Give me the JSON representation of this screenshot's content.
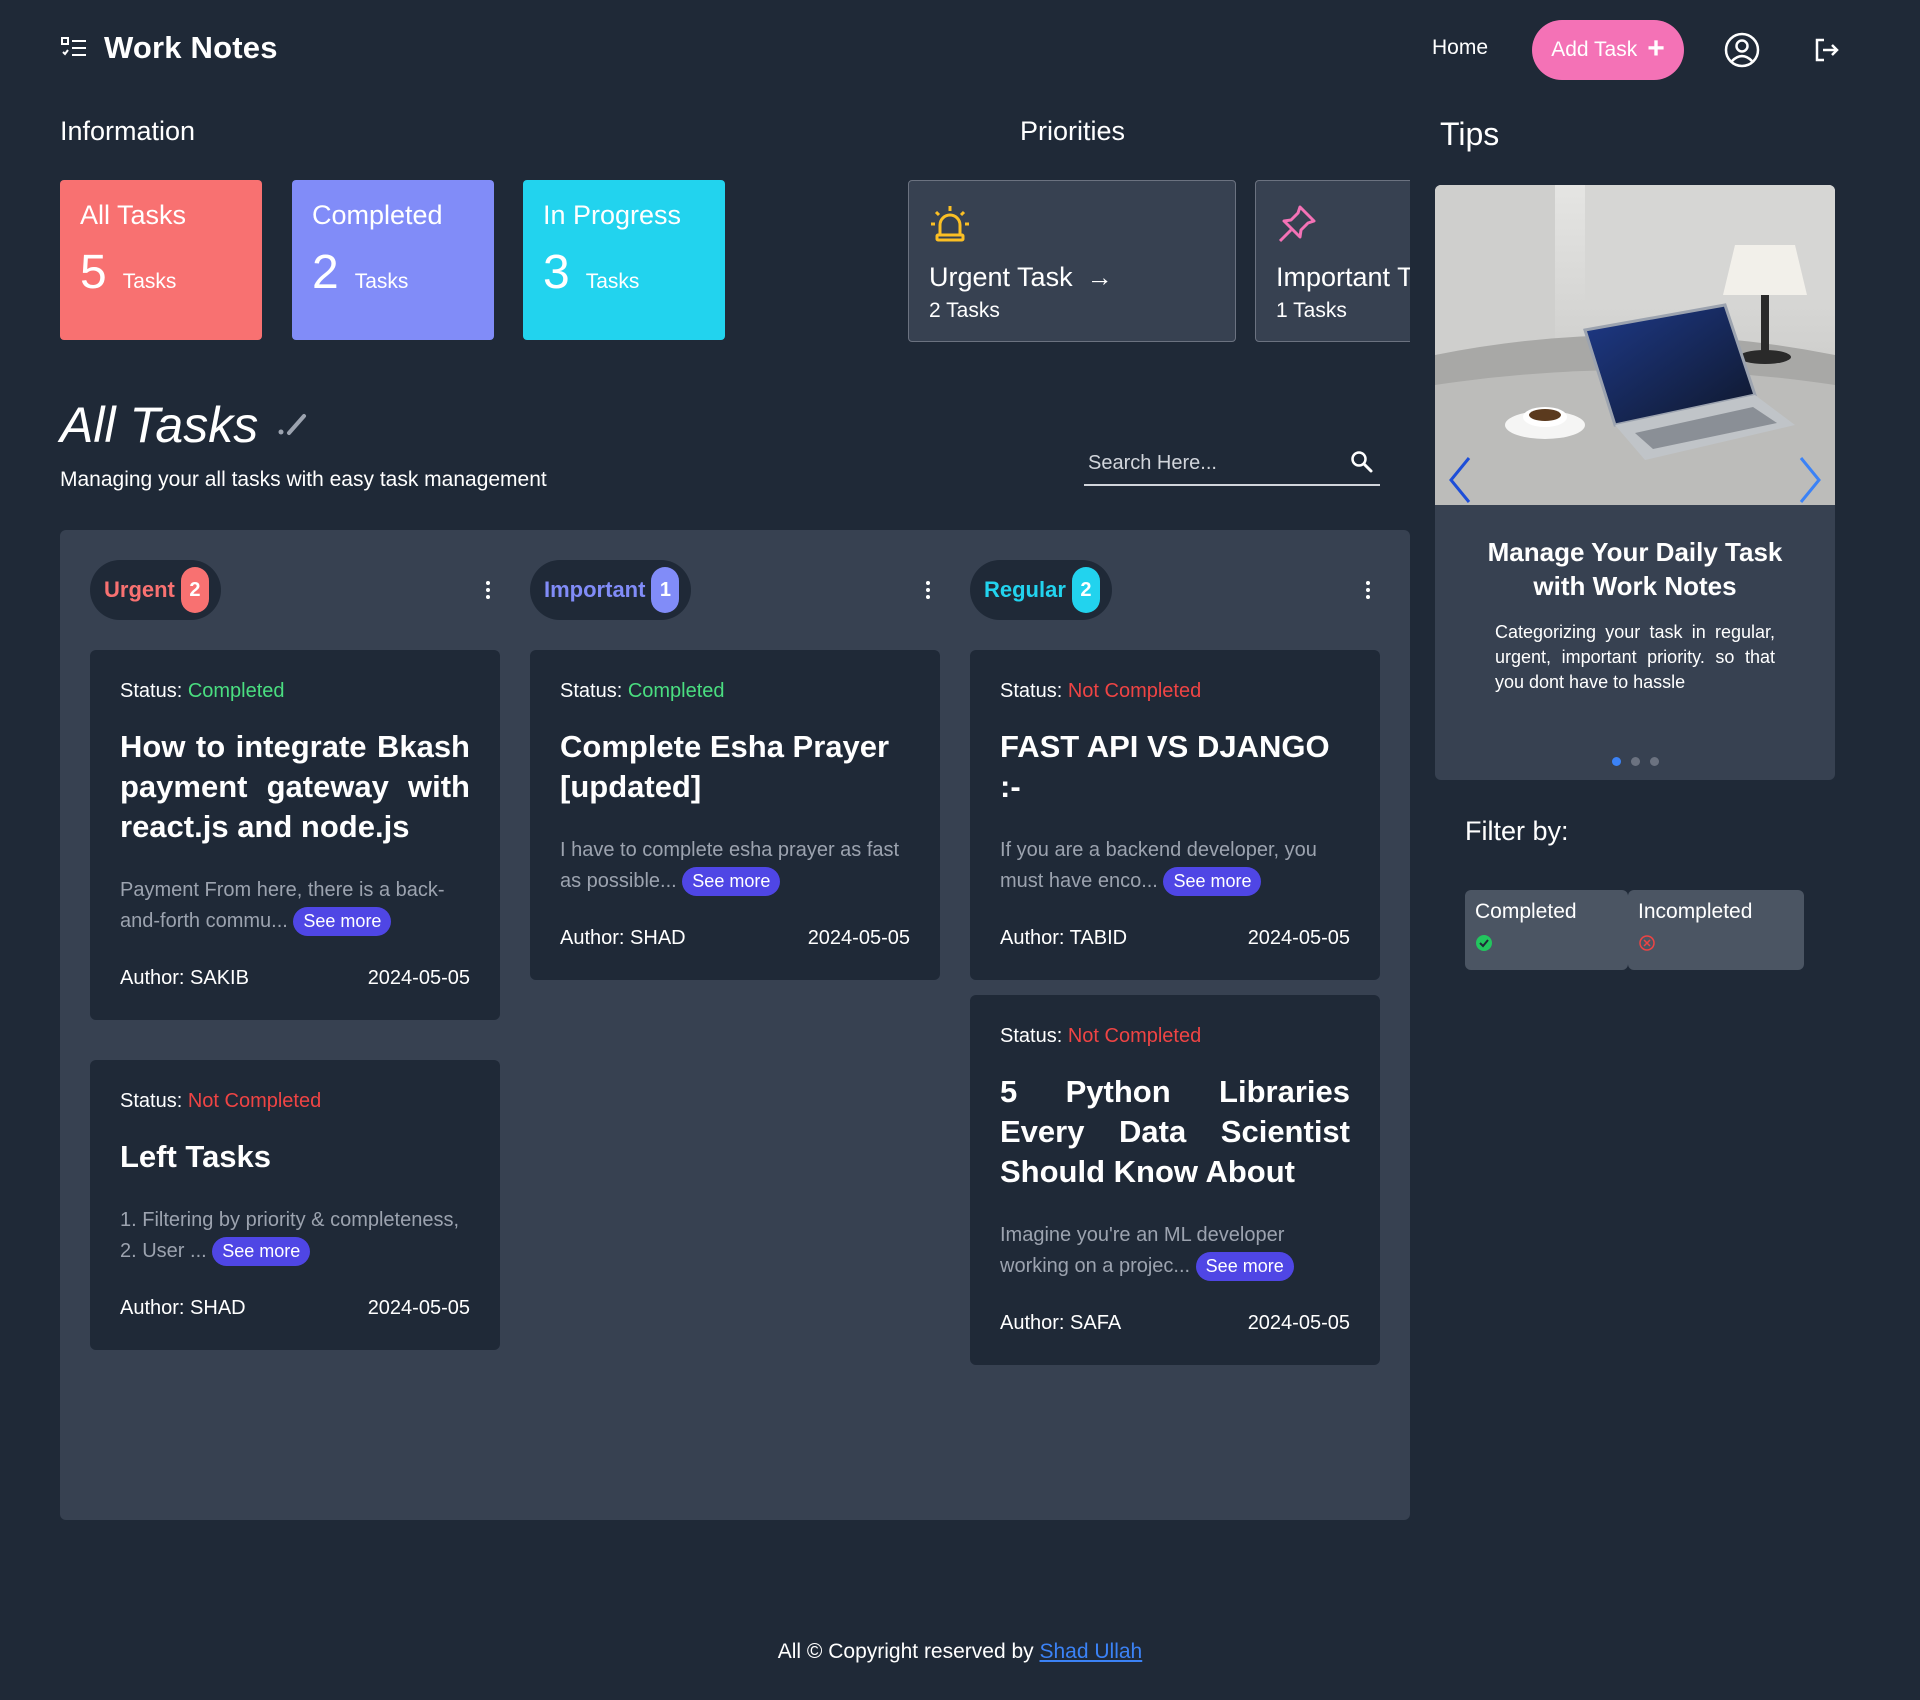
{
  "nav": {
    "brand": "Work Notes",
    "home": "Home",
    "add_task": "Add Task"
  },
  "information": {
    "label": "Information",
    "cards": [
      {
        "name": "All Tasks",
        "count": "5",
        "unit": "Tasks",
        "color": "#f87171"
      },
      {
        "name": "Completed",
        "count": "2",
        "unit": "Tasks",
        "color": "#818cf8"
      },
      {
        "name": "In Progress",
        "count": "3",
        "unit": "Tasks",
        "color": "#22d3ee"
      }
    ]
  },
  "priorities": {
    "label": "Priorities",
    "cards": [
      {
        "name": "Urgent Task",
        "count": "2 Tasks",
        "icon": "siren-icon"
      },
      {
        "name": "Important Task",
        "count": "1 Tasks",
        "icon": "pin-icon"
      }
    ]
  },
  "all_tasks": {
    "title": "All Tasks",
    "subtitle": "Managing your all tasks with easy task management",
    "search_placeholder": "Search Here..."
  },
  "columns": [
    {
      "label": "Urgent",
      "badge": "2",
      "color": "#f87171"
    },
    {
      "label": "Important",
      "badge": "1",
      "color": "#818cf8"
    },
    {
      "label": "Regular",
      "badge": "2",
      "color": "#22d3ee"
    }
  ],
  "tasks": {
    "status_label": "Status:",
    "see_more": "See more",
    "urgent": [
      {
        "status": "Completed",
        "title": "How to integrate Bkash payment gateway with react.js and node.js",
        "desc": "Payment From here, there is a back-and-forth commu...",
        "author": "Author: SAKIB",
        "date": "2024-05-05"
      },
      {
        "status": "Not Completed",
        "title": "Left Tasks",
        "desc": "1. Filtering by priority & completeness, 2. User ...",
        "author": "Author: SHAD",
        "date": "2024-05-05"
      }
    ],
    "important": [
      {
        "status": "Completed",
        "title": "Complete Esha Prayer [updated]",
        "desc": "I have to complete esha prayer as fast as possible...",
        "author": "Author: SHAD",
        "date": "2024-05-05"
      }
    ],
    "regular": [
      {
        "status": "Not Completed",
        "title": "FAST API VS DJANGO :-",
        "desc": "If you are a backend developer, you must have enco...",
        "author": "Author: TABID",
        "date": "2024-05-05"
      },
      {
        "status": "Not Completed",
        "title": "5 Python Libraries Every Data Scientist Should Know About",
        "desc": "Imagine you're an ML developer working on a projec...",
        "author": "Author: SAFA",
        "date": "2024-05-05"
      }
    ]
  },
  "tips": {
    "label": "Tips",
    "heading": "Manage Your Daily Task with Work Notes",
    "text": "Categorizing your task in regular, urgent, important priority. so that you dont have to hassle",
    "slides": 3,
    "active_slide": 1
  },
  "filter": {
    "label": "Filter by:",
    "options": [
      {
        "label": "Completed",
        "icon": "check-circle-icon",
        "color": "#22c55e"
      },
      {
        "label": "Incompleted",
        "icon": "x-circle-icon",
        "color": "#ef4444"
      }
    ]
  },
  "footer": {
    "text": "All © Copyright reserved by ",
    "author": "Shad Ullah"
  }
}
